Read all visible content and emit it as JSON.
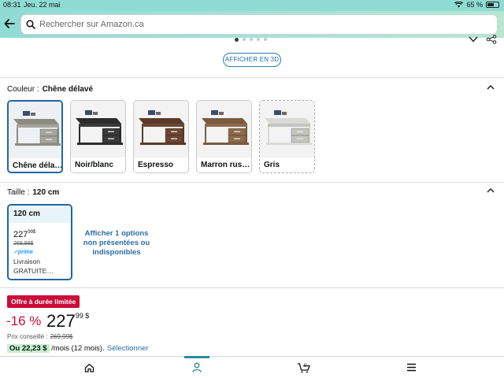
{
  "status_bar": {
    "time": "08:31",
    "date": "Jeu. 22 mai",
    "battery_text": "65 %",
    "battery_level": 0.65
  },
  "search": {
    "placeholder": "Rechercher sur Amazon.ca",
    "value": ""
  },
  "carousel": {
    "total_dots": 5,
    "active_index": 0
  },
  "view_3d_label": "AFFICHER EN 3D",
  "color_section": {
    "label": "Couleur :",
    "selected": "Chêne délavé",
    "options": [
      {
        "label": "Chêne déla…",
        "table_color": "#8c8c82",
        "drawer_color": "#a6a59c",
        "state": "selected"
      },
      {
        "label": "Noir/blanc",
        "table_color": "#2c2c2c",
        "drawer_color": "#3a3a3a",
        "state": "available"
      },
      {
        "label": "Espresso",
        "table_color": "#5a3a2a",
        "drawer_color": "#6e4633",
        "state": "available"
      },
      {
        "label": "Marron rus…",
        "table_color": "#7a5a40",
        "drawer_color": "#8e6a4d",
        "state": "available"
      },
      {
        "label": "Gris",
        "table_color": "#d9d9d6",
        "drawer_color": "#c4c4bf",
        "state": "unavailable"
      }
    ]
  },
  "size_section": {
    "label": "Taille :",
    "selected": "120 cm",
    "card": {
      "name": "120 cm",
      "price_whole": "227",
      "price_fraction": "99",
      "currency": "$",
      "old_price": "269,99$",
      "prime": "✓prime",
      "delivery_line1": "Livraison",
      "delivery_line2": "GRATUITE…"
    },
    "more_options": "Afficher 1 options non présentées ou indisponibles"
  },
  "deal": {
    "badge": "Offre à durée limitée",
    "discount": "-16 %",
    "price_whole": "227",
    "price_fraction": "99",
    "currency": "$",
    "list_price_label": "Prix conseillé :",
    "list_price": "269,99$",
    "monthly_amount": "Ou 22,23 $",
    "monthly_rest": "/mois (12 mois).",
    "select_label": "Sélectionner"
  },
  "colors": {
    "accent": "#2165a6",
    "deal_red": "#cc0c39",
    "header_teal": "#8fdcd4",
    "nav_active": "#2a8a9a"
  },
  "bottom_nav": [
    {
      "name": "home-icon",
      "active": false
    },
    {
      "name": "account-icon",
      "active": true
    },
    {
      "name": "cart-icon",
      "active": false,
      "count": "0"
    },
    {
      "name": "menu-icon",
      "active": false
    }
  ]
}
